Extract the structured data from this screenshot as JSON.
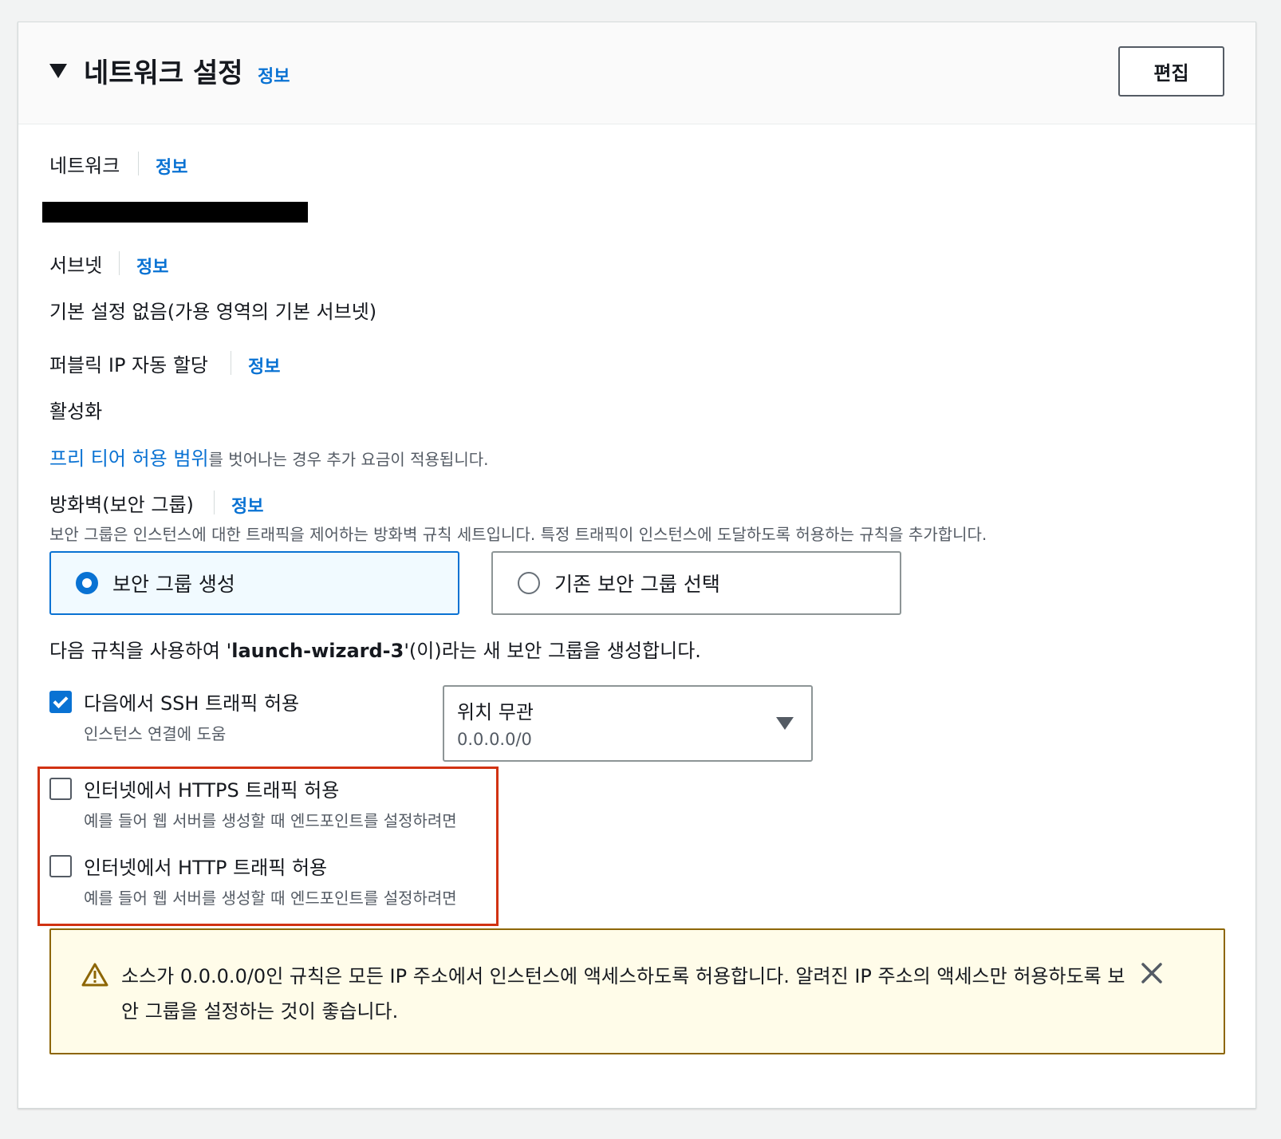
{
  "header": {
    "title": "네트워크 설정",
    "info": "정보",
    "edit_button": "편집"
  },
  "network": {
    "label": "네트워크",
    "info": "정보"
  },
  "subnet": {
    "label": "서브넷",
    "info": "정보",
    "value": "기본 설정 없음(가용 영역의 기본 서브넷)"
  },
  "public_ip": {
    "label": "퍼블릭 IP 자동 할당",
    "info": "정보",
    "value": "활성화"
  },
  "free_tier": {
    "link": "프리 티어 허용 범위",
    "text": "를 벗어나는 경우 추가 요금이 적용됩니다."
  },
  "firewall": {
    "label": "방화벽(보안 그룹)",
    "info": "정보",
    "description": "보안 그룹은 인스턴스에 대한 트래픽을 제어하는 방화벽 규칙 세트입니다. 특정 트래픽이 인스턴스에 도달하도록 허용하는 규칙을 추가합니다.",
    "options": [
      {
        "label": "보안 그룹 생성",
        "selected": true
      },
      {
        "label": "기존 보안 그룹 선택",
        "selected": false
      }
    ]
  },
  "rule_summary": {
    "prefix": "다음 규칙을 사용하여 '",
    "name": "launch-wizard-3",
    "suffix": "'(이)라는 새 보안 그룹을 생성합니다."
  },
  "rules": [
    {
      "label": "다음에서 SSH 트래픽 허용",
      "description": "인스턴스 연결에 도움",
      "checked": true
    },
    {
      "label": "인터넷에서 HTTPS 트래픽 허용",
      "description": "예를 들어 웹 서버를 생성할 때 엔드포인트를 설정하려면",
      "checked": false
    },
    {
      "label": "인터넷에서 HTTP 트래픽 허용",
      "description": "예를 들어 웹 서버를 생성할 때 엔드포인트를 설정하려면",
      "checked": false
    }
  ],
  "ssh_source": {
    "label": "위치 무관",
    "value": "0.0.0.0/0"
  },
  "alert": {
    "text": "소스가 0.0.0.0/0인 규칙은 모든 IP 주소에서 인스턴스에 액세스하도록 허용합니다. 알려진 IP 주소의 액세스만 허용하도록 보안 그룹을 설정하는 것이 좋습니다."
  },
  "colors": {
    "accent": "#0972d3",
    "warning_border": "#8d6605",
    "warning_bg": "#fffce9",
    "highlight": "#d13212"
  },
  "icons": {
    "caret": "caret-down-icon",
    "warning": "warning-icon",
    "close": "close-icon",
    "select": "select-caret-icon"
  }
}
